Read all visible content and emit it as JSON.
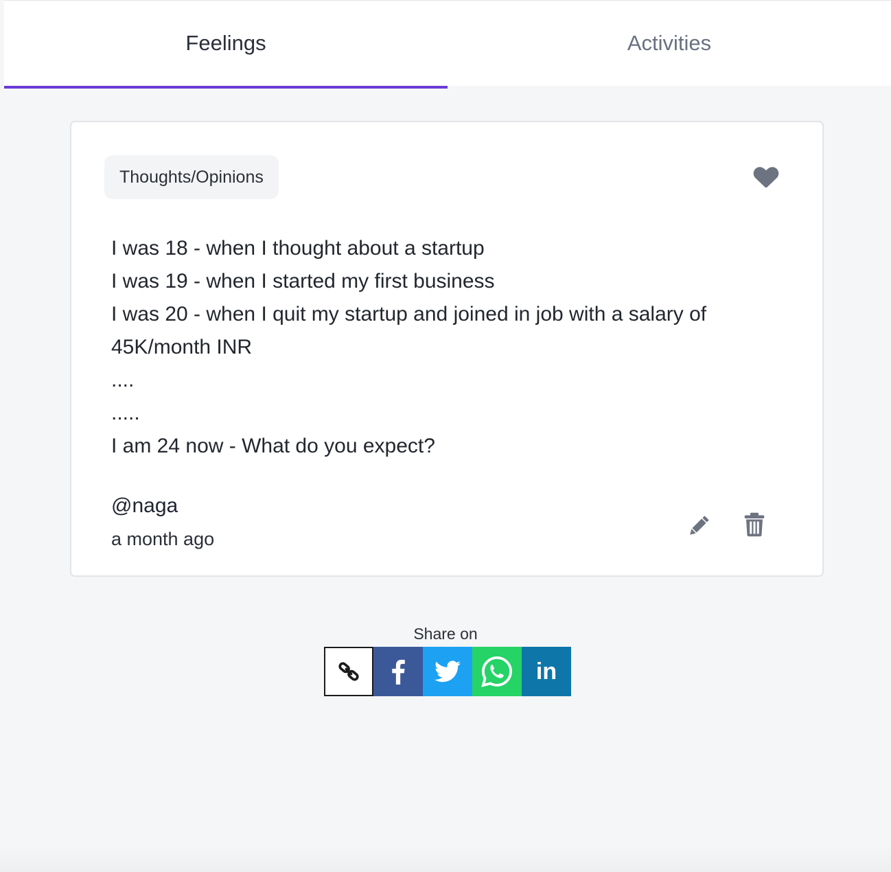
{
  "tabs": [
    {
      "label": "Feelings",
      "active": true
    },
    {
      "label": "Activities",
      "active": false
    }
  ],
  "post": {
    "category": "Thoughts/Opinions",
    "lines": [
      "I was 18 - when I thought about a startup",
      "I was 19 - when I started my first business",
      "I was 20 - when I quit my startup and joined in job with a salary of",
      "45K/month INR",
      "....",
      ".....",
      "I am 24 now - What do you expect?"
    ],
    "author": "@naga",
    "time": "a month ago",
    "icons": {
      "like": "heart-icon",
      "edit": "pencil-icon",
      "delete": "trash-icon"
    }
  },
  "share": {
    "label": "Share on",
    "buttons": [
      {
        "name": "copy-link",
        "icon": "link-icon",
        "color": "#ffffff"
      },
      {
        "name": "facebook",
        "icon": "facebook-icon",
        "color": "#3b5998"
      },
      {
        "name": "twitter",
        "icon": "twitter-icon",
        "color": "#1da1f2"
      },
      {
        "name": "whatsapp",
        "icon": "whatsapp-icon",
        "color": "#25d366"
      },
      {
        "name": "linkedin",
        "icon": "linkedin-icon",
        "color": "#0e76a8",
        "text": "in"
      }
    ]
  },
  "colors": {
    "accent": "#6b3bd6",
    "icon_gray": "#6e7381",
    "background": "#f5f6f8"
  }
}
